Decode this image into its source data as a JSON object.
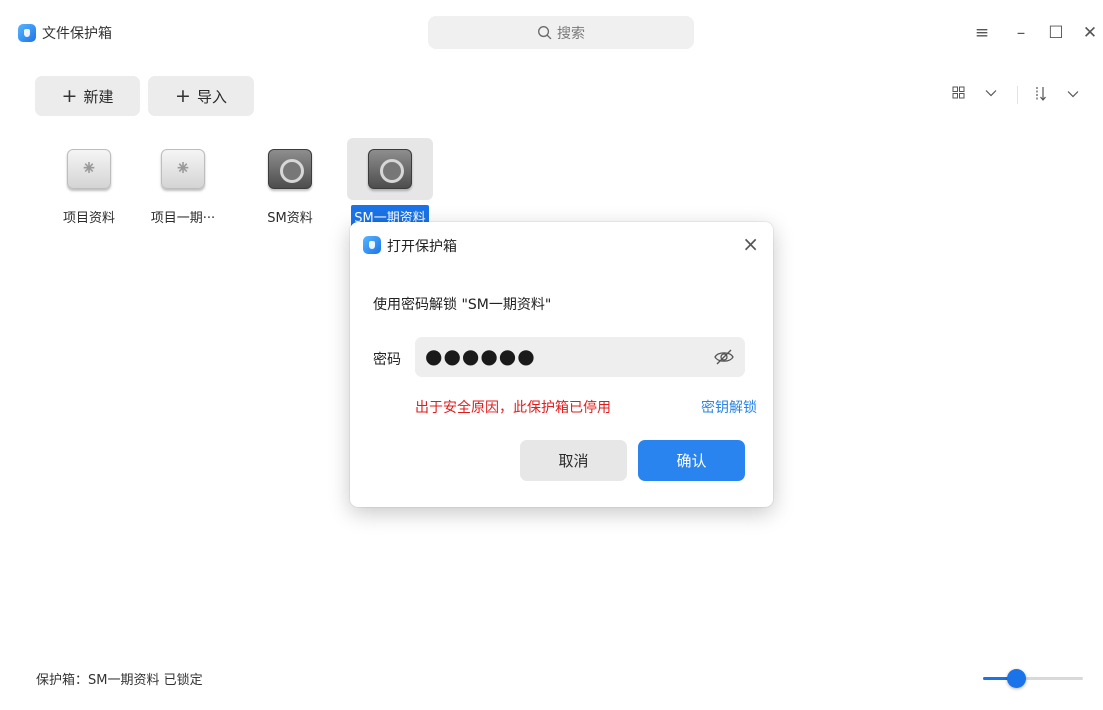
{
  "app": {
    "title": "文件保护箱",
    "search_placeholder": "搜索",
    "window_controls": {
      "menu": "≡",
      "minimize": "–",
      "maximize": "☐",
      "close": "✕"
    }
  },
  "toolbar": {
    "new_label": "新建",
    "import_label": "导入",
    "plus": "+",
    "view_icon": "grid-view-icon",
    "sort_icon": "sort-icon",
    "chevron": "⌄"
  },
  "vaults": [
    {
      "label": "项目资料",
      "state": "unlocked",
      "selected": false
    },
    {
      "label": "项目一期···",
      "state": "unlocked",
      "selected": false
    },
    {
      "label": "SM资料",
      "state": "locked",
      "selected": false
    },
    {
      "label": "SM一期资料",
      "state": "locked",
      "selected": true
    }
  ],
  "dialog": {
    "title": "打开保护箱",
    "close": "×",
    "message": "使用密码解锁 \"SM一期资料\"",
    "password_label": "密码",
    "password_value": "●●●●●●",
    "warning": "出于安全原因，此保护箱已停用",
    "key_unlock_link": "密钥解锁",
    "cancel_label": "取消",
    "confirm_label": "确认"
  },
  "statusbar": {
    "text": "保护箱：SM一期资料   已锁定",
    "zoom_fraction": 0.33
  },
  "colors": {
    "accent": "#1a73e8",
    "warning": "#e21b1b",
    "link": "#2a84e9"
  }
}
